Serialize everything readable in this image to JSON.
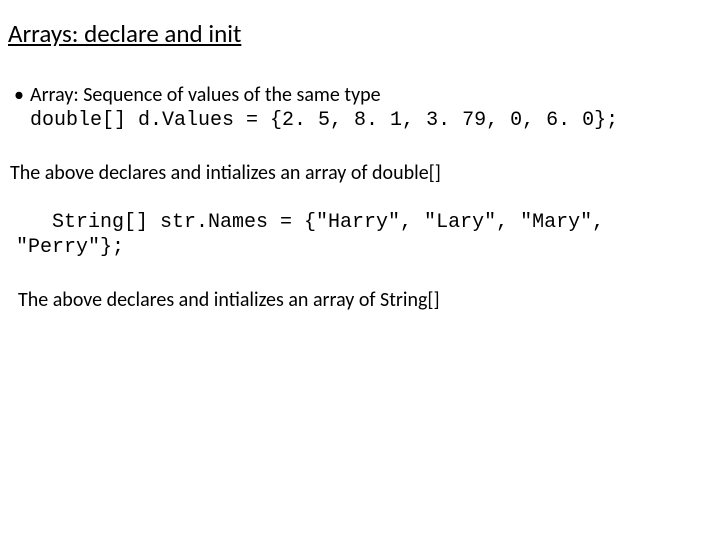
{
  "title": "Arrays: declare and init",
  "bullet": {
    "text": "Array: Sequence of values of the same type"
  },
  "code1": "double[] d.Values = {2. 5, 8. 1, 3. 79, 0, 6. 0};",
  "para1": "The above declares and intializes an array of double[]",
  "code2_line1": "String[] str.Names = {\"Harry\", \"Lary\", \"Mary\",",
  "code2_line2": "\"Perry\"};",
  "para2": "The above declares and intializes an array of String[]"
}
